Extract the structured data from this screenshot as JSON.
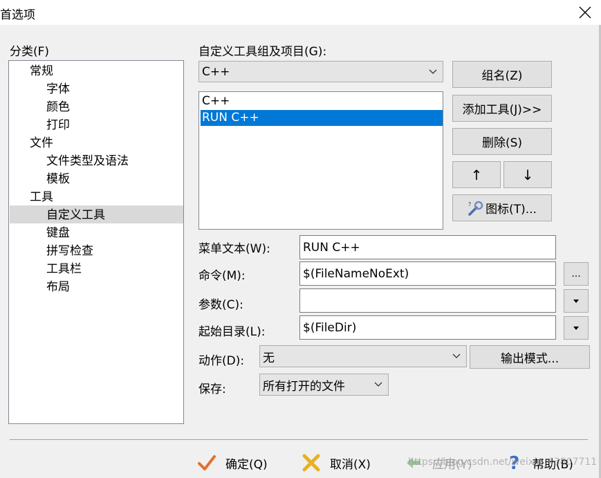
{
  "window": {
    "title": "首选项"
  },
  "category": {
    "label": "分类(F)",
    "items": [
      "常规",
      "字体",
      "颜色",
      "打印",
      "文件",
      "文件类型及语法",
      "模板",
      "工具",
      "自定义工具",
      "键盘",
      "拼写检查",
      "工具栏",
      "布局"
    ],
    "selected": "自定义工具"
  },
  "tools": {
    "group_label": "自定义工具组及项目(G):",
    "group_selected": "C++",
    "list": [
      "C++",
      "RUN C++"
    ],
    "list_selected": "RUN C++",
    "buttons": {
      "group": "组名(Z)",
      "add": "添加工具(J)>>",
      "delete": "删除(S)",
      "up": "↑",
      "down": "↓",
      "icon": "图标(T)..."
    }
  },
  "fields": {
    "menu_text_label": "菜单文本(W):",
    "menu_text_value": "RUN C++",
    "command_label": "命令(M):",
    "command_value": "$(FileNameNoExt)",
    "command_browse": "...",
    "params_label": "参数(C):",
    "params_value": "",
    "startdir_label": "起始目录(L):",
    "startdir_value": "$(FileDir)",
    "action_label": "动作(D):",
    "action_value": "无",
    "output_button": "输出模式...",
    "save_label": "保存:",
    "save_value": "所有打开的文件"
  },
  "footer": {
    "ok": "确定(Q)",
    "cancel": "取消(X)",
    "apply": "应用(Y)",
    "help": "帮助(B)"
  },
  "watermark": "https://blog.csdn.net/weixin_43807711"
}
